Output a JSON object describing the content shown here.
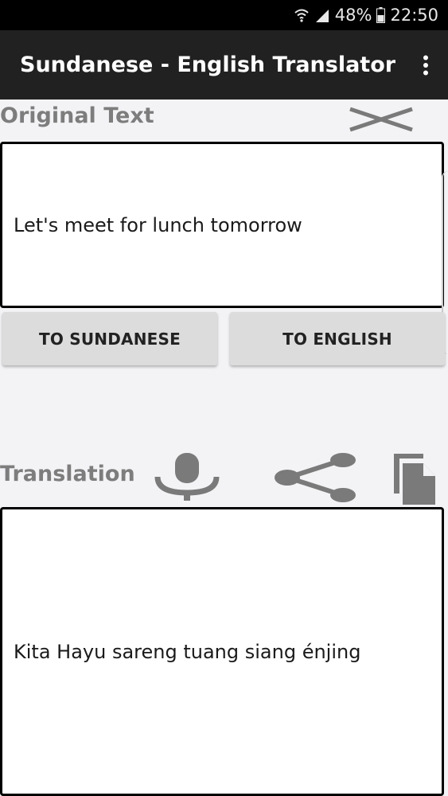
{
  "status_bar": {
    "battery_percent": "48%",
    "time": "22:50",
    "icons": [
      "wifi-icon",
      "signal-icon",
      "battery-icon"
    ]
  },
  "app_bar": {
    "title": "Sundanese - English Translator",
    "menu_icon": "overflow-menu-icon"
  },
  "original": {
    "label": "Original Text",
    "text": "Let's meet for lunch tomorrow",
    "clear_icon": "clear-icon"
  },
  "buttons": {
    "to_sundanese": "TO SUNDANESE",
    "to_english": "TO ENGLISH"
  },
  "translation": {
    "label": "Translation",
    "text": "Kita Hayu sareng tuang siang énjing",
    "icons": [
      "microphone-icon",
      "share-icon",
      "copy-icon"
    ]
  },
  "colors": {
    "app_bar": "#212121",
    "background": "#f3f2f5",
    "label_gray": "#7d7d7d",
    "icon_gray": "#7a7a7a",
    "button_bg": "#dcdcdc"
  }
}
